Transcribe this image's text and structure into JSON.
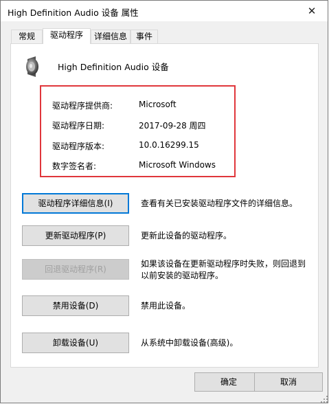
{
  "window": {
    "title": "High Definition Audio 设备 属性",
    "close_glyph": "✕"
  },
  "tabs": [
    {
      "label": "常规"
    },
    {
      "label": "驱动程序"
    },
    {
      "label": "详细信息"
    },
    {
      "label": "事件"
    }
  ],
  "device": {
    "name": "High Definition Audio 设备",
    "icon": "speaker-icon"
  },
  "info": {
    "provider_label": "驱动程序提供商:",
    "provider_value": "Microsoft",
    "date_label": "驱动程序日期:",
    "date_value": "2017-09-28 周四",
    "version_label": "驱动程序版本:",
    "version_value": "10.0.16299.15",
    "signer_label": "数字签名者:",
    "signer_value": "Microsoft Windows"
  },
  "actions": {
    "details": {
      "label": "驱动程序详细信息(I)",
      "desc": "查看有关已安装驱动程序文件的详细信息。"
    },
    "update": {
      "label": "更新驱动程序(P)",
      "desc": "更新此设备的驱动程序。"
    },
    "rollback": {
      "label": "回退驱动程序(R)",
      "desc": "如果该设备在更新驱动程序时失败，则回退到以前安装的驱动程序。"
    },
    "disable": {
      "label": "禁用设备(D)",
      "desc": "禁用此设备。"
    },
    "uninstall": {
      "label": "卸载设备(U)",
      "desc": "从系统中卸载设备(高级)。"
    }
  },
  "footer": {
    "ok_label": "确定",
    "cancel_label": "取消"
  },
  "colors": {
    "highlight_border": "#e0363b",
    "focus": "#0078d7"
  }
}
